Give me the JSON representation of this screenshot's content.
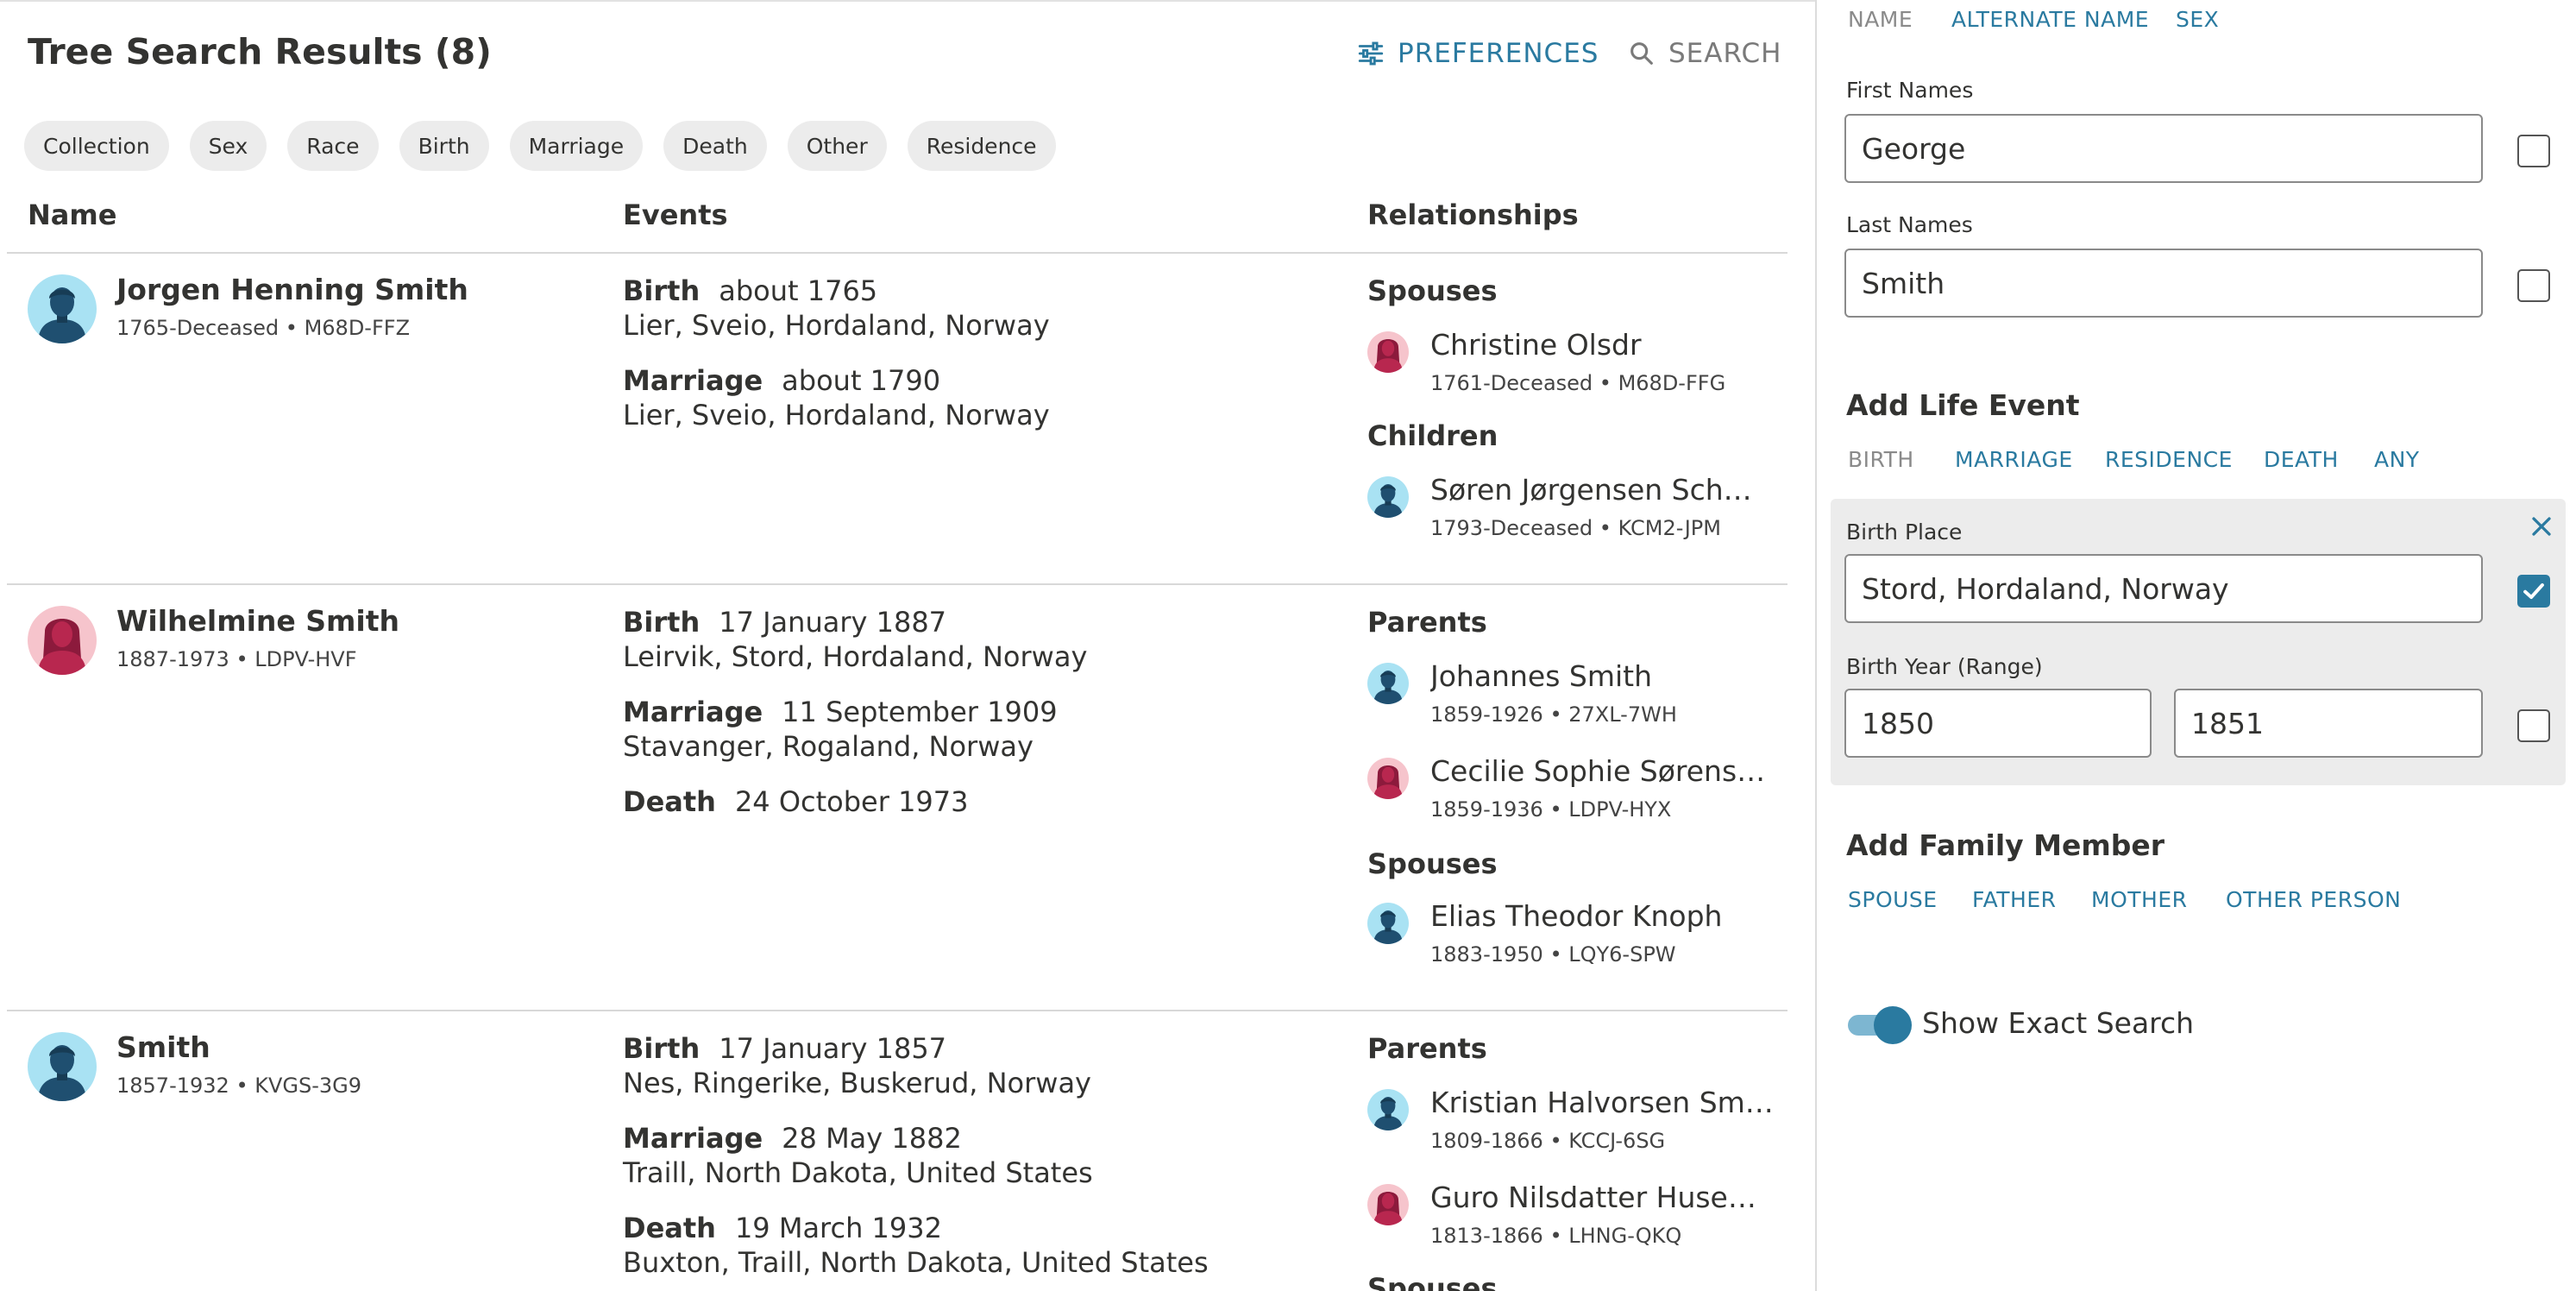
{
  "main": {
    "title": "Tree Search Results (8)",
    "preferences_label": "PREFERENCES",
    "search_label": "SEARCH",
    "filters": [
      "Collection",
      "Sex",
      "Race",
      "Birth",
      "Marriage",
      "Death",
      "Other",
      "Residence"
    ],
    "columns": {
      "name": "Name",
      "events": "Events",
      "relationships": "Relationships"
    },
    "results": [
      {
        "name": "Jorgen Henning Smith",
        "meta": "1765-Deceased • M68D-FFZ",
        "sex": "male",
        "events": [
          {
            "type": "Birth",
            "date": "about 1765",
            "place": "Lier, Sveio, Hordaland, Norway"
          },
          {
            "type": "Marriage",
            "date": "about 1790",
            "place": "Lier, Sveio, Hordaland, Norway"
          }
        ],
        "groups": [
          {
            "heading": "Spouses",
            "people": [
              {
                "name": "Christine Olsdr",
                "meta": "1761-Deceased • M68D-FFG",
                "sex": "female"
              }
            ]
          },
          {
            "heading": "Children",
            "people": [
              {
                "name": "Søren Jørgensen Schmidt",
                "meta": "1793-Deceased • KCM2-JPM",
                "sex": "male"
              }
            ]
          }
        ]
      },
      {
        "name": "Wilhelmine Smith",
        "meta": "1887-1973 • LDPV-HVF",
        "sex": "female",
        "events": [
          {
            "type": "Birth",
            "date": "17 January 1887",
            "place": "Leirvik, Stord, Hordaland, Norway"
          },
          {
            "type": "Marriage",
            "date": "11 September 1909",
            "place": "Stavanger, Rogaland, Norway"
          },
          {
            "type": "Death",
            "date": "24 October 1973",
            "place": ""
          }
        ],
        "groups": [
          {
            "heading": "Parents",
            "people": [
              {
                "name": "Johannes Smith",
                "meta": "1859-1926 • 27XL-7WH",
                "sex": "male"
              },
              {
                "name": "Cecilie Sophie Sørensdat...",
                "meta": "1859-1936 • LDPV-HYX",
                "sex": "female"
              }
            ]
          },
          {
            "heading": "Spouses",
            "people": [
              {
                "name": "Elias Theodor Knoph",
                "meta": "1883-1950 • LQY6-SPW",
                "sex": "male"
              }
            ]
          }
        ]
      },
      {
        "name": "Smith",
        "meta": "1857-1932 • KVGS-3G9",
        "sex": "male",
        "events": [
          {
            "type": "Birth",
            "date": "17 January 1857",
            "place": "Nes, Ringerike, Buskerud, Norway"
          },
          {
            "type": "Marriage",
            "date": "28 May 1882",
            "place": "Traill, North Dakota, United States"
          },
          {
            "type": "Death",
            "date": "19 March 1932",
            "place": "Buxton, Traill, North Dakota, United States"
          }
        ],
        "groups": [
          {
            "heading": "Parents",
            "people": [
              {
                "name": "Kristian Halvorsen Smette",
                "meta": "1809-1866 • KCCJ-6SG",
                "sex": "male"
              },
              {
                "name": "Guro Nilsdatter Husemo...",
                "meta": "1813-1866 • LHNG-QKQ",
                "sex": "female"
              }
            ]
          },
          {
            "heading": "Spouses",
            "people": []
          }
        ]
      }
    ]
  },
  "side": {
    "tabs": [
      "NAME",
      "ALTERNATE NAME",
      "SEX"
    ],
    "first_names_label": "First Names",
    "first_names_value": "George",
    "last_names_label": "Last Names",
    "last_names_value": "Smith",
    "life_event_title": "Add Life Event",
    "life_event_tabs": [
      "BIRTH",
      "MARRIAGE",
      "RESIDENCE",
      "DEATH",
      "ANY"
    ],
    "birth_place_label": "Birth Place",
    "birth_place_value": "Stord, Hordaland, Norway",
    "birth_place_checked": true,
    "birth_year_label": "Birth Year (Range)",
    "birth_year_from": "1850",
    "birth_year_to": "1851",
    "family_title": "Add Family Member",
    "family_tabs": [
      "SPOUSE",
      "FATHER",
      "MOTHER",
      "OTHER PERSON"
    ],
    "exact_search_label": "Show Exact Search",
    "exact_search_on": true
  },
  "colors": {
    "accent": "#2a7aa0",
    "male_avatar": "#a9e2f3",
    "female_avatar": "#f6c4cc"
  }
}
